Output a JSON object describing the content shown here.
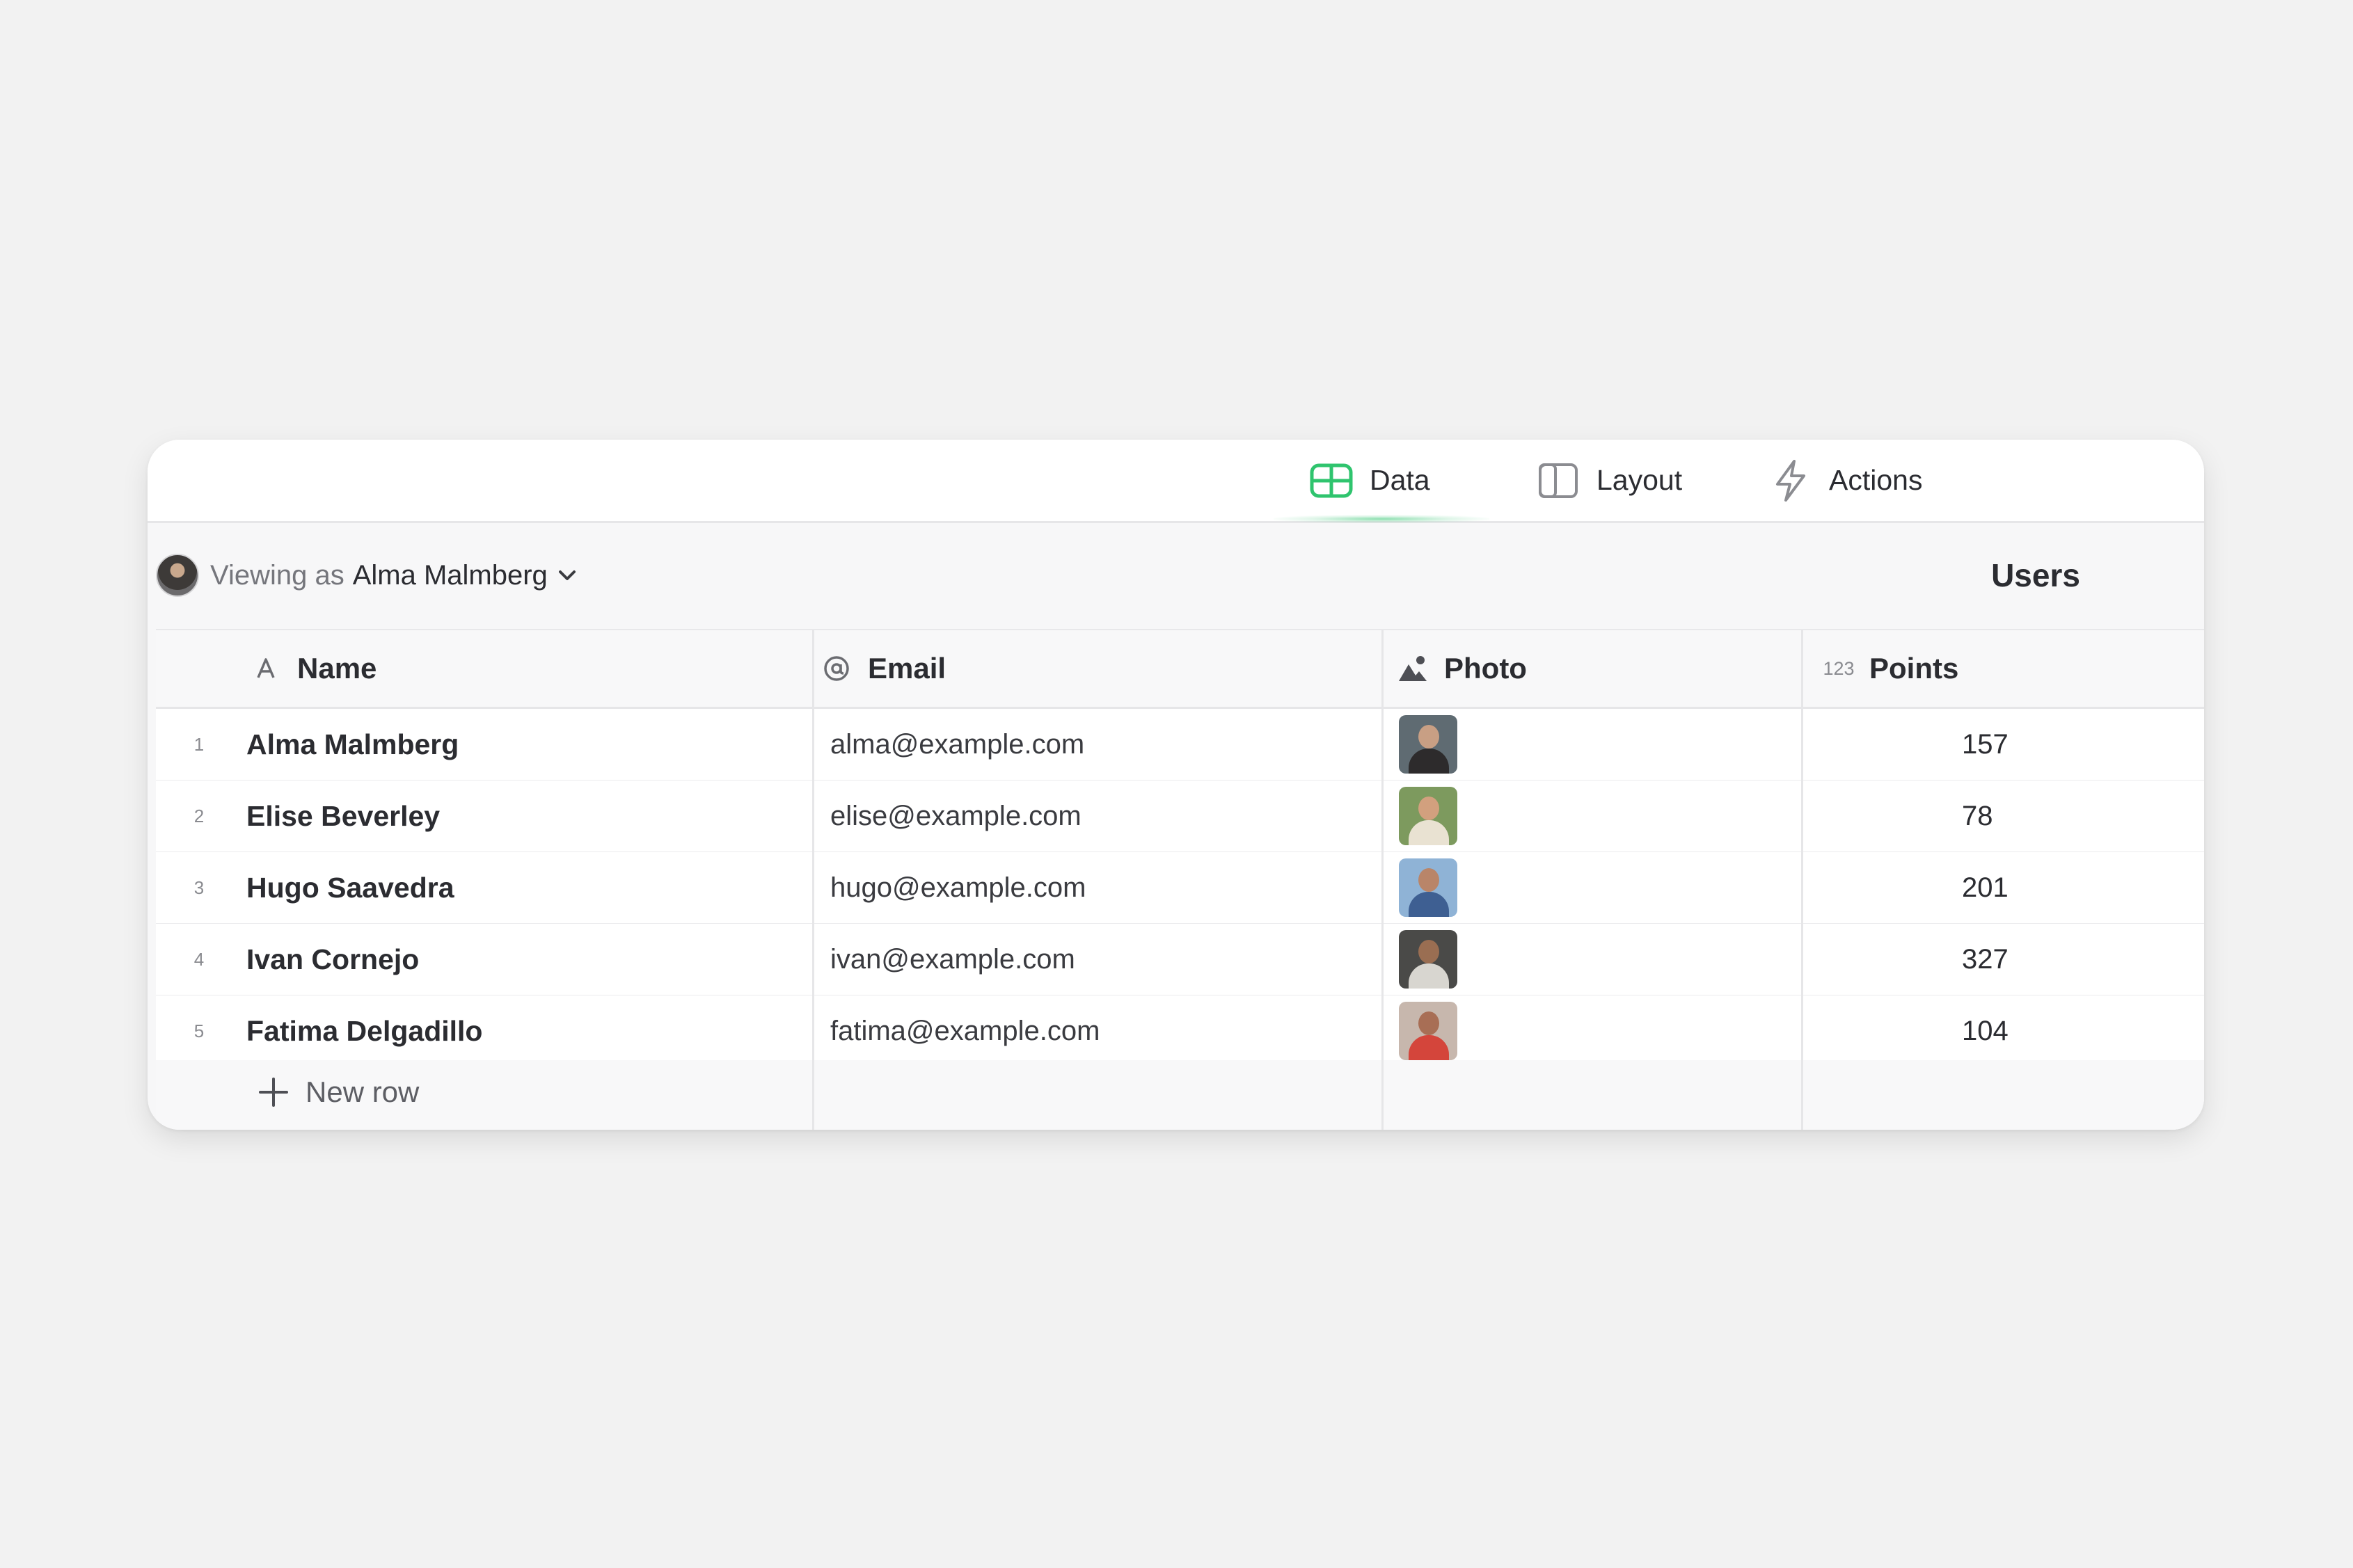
{
  "tabs": [
    {
      "label": "Data",
      "icon": "table-icon",
      "active": true
    },
    {
      "label": "Layout",
      "icon": "layout-icon",
      "active": false
    },
    {
      "label": "Actions",
      "icon": "bolt-icon",
      "active": false
    }
  ],
  "viewing": {
    "prefix": "Viewing as",
    "user": "Alma Malmberg"
  },
  "table_title": "Users",
  "columns": [
    {
      "label": "Name",
      "icon": "text-type-icon"
    },
    {
      "label": "Email",
      "icon": "at-sign-icon"
    },
    {
      "label": "Photo",
      "icon": "image-icon"
    },
    {
      "label": "Points",
      "icon": "number-type-icon",
      "icon_text": "123"
    }
  ],
  "rows": [
    {
      "num": "1",
      "name": "Alma Malmberg",
      "email": "alma@example.com",
      "points": "157"
    },
    {
      "num": "2",
      "name": "Elise Beverley",
      "email": "elise@example.com",
      "points": "78"
    },
    {
      "num": "3",
      "name": "Hugo Saavedra",
      "email": "hugo@example.com",
      "points": "201"
    },
    {
      "num": "4",
      "name": "Ivan Cornejo",
      "email": "ivan@example.com",
      "points": "327"
    },
    {
      "num": "5",
      "name": "Fatima Delgadillo",
      "email": "fatima@example.com",
      "points": "104"
    }
  ],
  "new_row_label": "New row",
  "colors": {
    "accent": "#2fc46e",
    "background": "#f2f2f2"
  }
}
